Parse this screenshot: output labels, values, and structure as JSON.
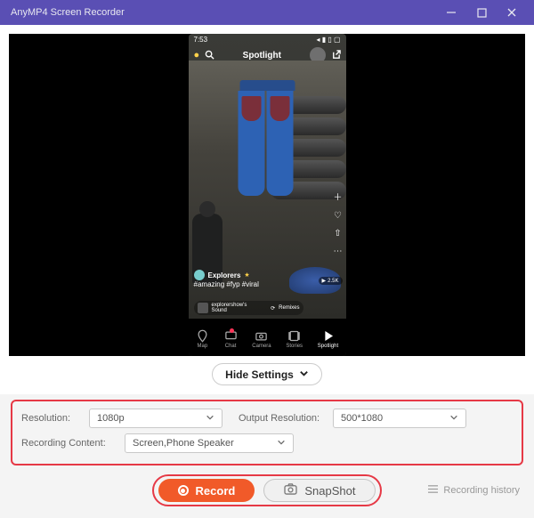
{
  "titlebar": {
    "title": "AnyMP4 Screen Recorder"
  },
  "phone": {
    "time": "7:53",
    "signal_icons": "◂ ▮ ▯ ▢",
    "spotlight": "Spotlight",
    "user": "Explorers",
    "hashtags": "#amazing #fyp #viral",
    "sound_user": "explorershow's",
    "sound_label": "Sound",
    "remix": "Remixes",
    "views": "2.5K",
    "nav": {
      "map": "Map",
      "chat": "Chat",
      "camera": "Camera",
      "stories": "Stories",
      "spotlight": "Spotlight"
    }
  },
  "hide_settings": "Hide Settings",
  "settings": {
    "resolution_label": "Resolution:",
    "resolution_value": "1080p",
    "output_label": "Output Resolution:",
    "output_value": "500*1080",
    "content_label": "Recording Content:",
    "content_value": "Screen,Phone Speaker"
  },
  "buttons": {
    "record": "Record",
    "snapshot": "SnapShot"
  },
  "history": "Recording history"
}
